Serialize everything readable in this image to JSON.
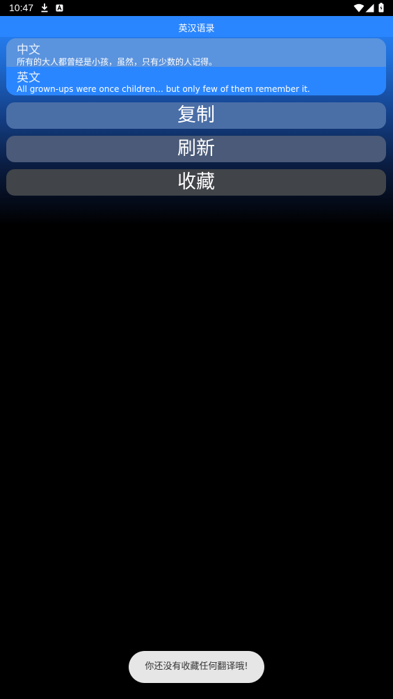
{
  "status_bar": {
    "time": "10:47",
    "icons": [
      "download-icon",
      "notification-a-icon",
      "wifi-icon",
      "signal-icon",
      "battery-icon"
    ]
  },
  "app": {
    "title": "英汉语录",
    "chinese_label": "中文",
    "chinese_text": "所有的大人都曾经是小孩，虽然，只有少数的人记得。",
    "english_label": "英文",
    "english_text": "All grown-ups were once children... but only few of them remember it.",
    "buttons": {
      "copy": "复制",
      "refresh": "刷新",
      "favorite": "收藏"
    },
    "toast": "你还没有收藏任何翻译哦!"
  },
  "colors": {
    "accent": "#2a86ff",
    "background": "#000000"
  }
}
